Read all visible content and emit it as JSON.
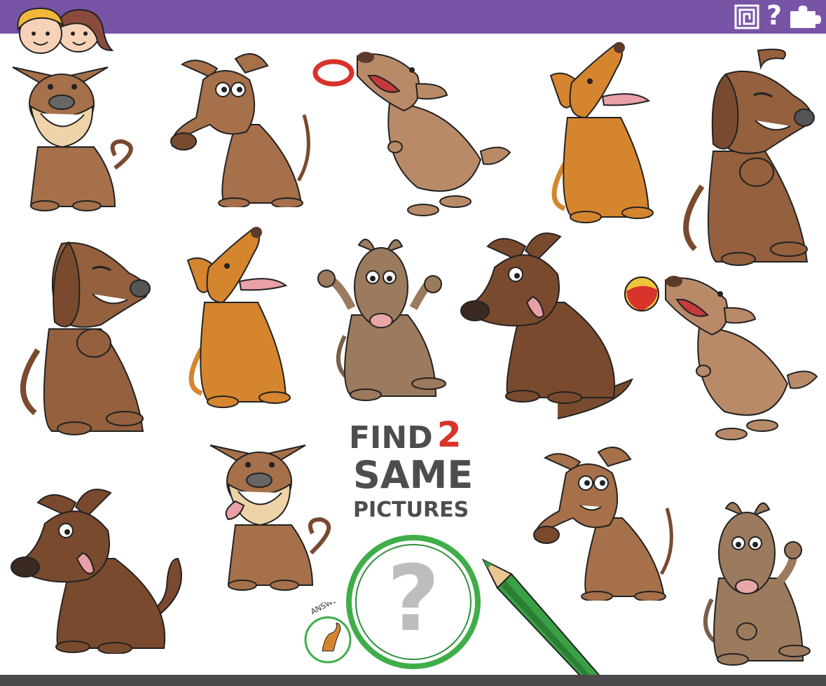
{
  "header": {
    "bar_color": "#7754a6",
    "icons": [
      "spiral-icon",
      "question-mark-icon",
      "puzzle-piece-icon"
    ],
    "help_glyph": "?"
  },
  "puzzle": {
    "title_find": "FIND",
    "title_number": "2",
    "title_same": "SAME",
    "title_pictures": "PICTURES",
    "title_color": "#4d4d4d",
    "number_color": "#d8332b"
  },
  "answer": {
    "label": "ANSWER",
    "magnifier_glyph": "?"
  },
  "colors": {
    "dog_brown": "#a5704a",
    "dog_dark": "#7a4a2e",
    "dog_orange": "#d5852e",
    "dog_taupe": "#9b7a5d",
    "magnifier_ring": "#3fae49",
    "pencil_green": "#39a045"
  }
}
